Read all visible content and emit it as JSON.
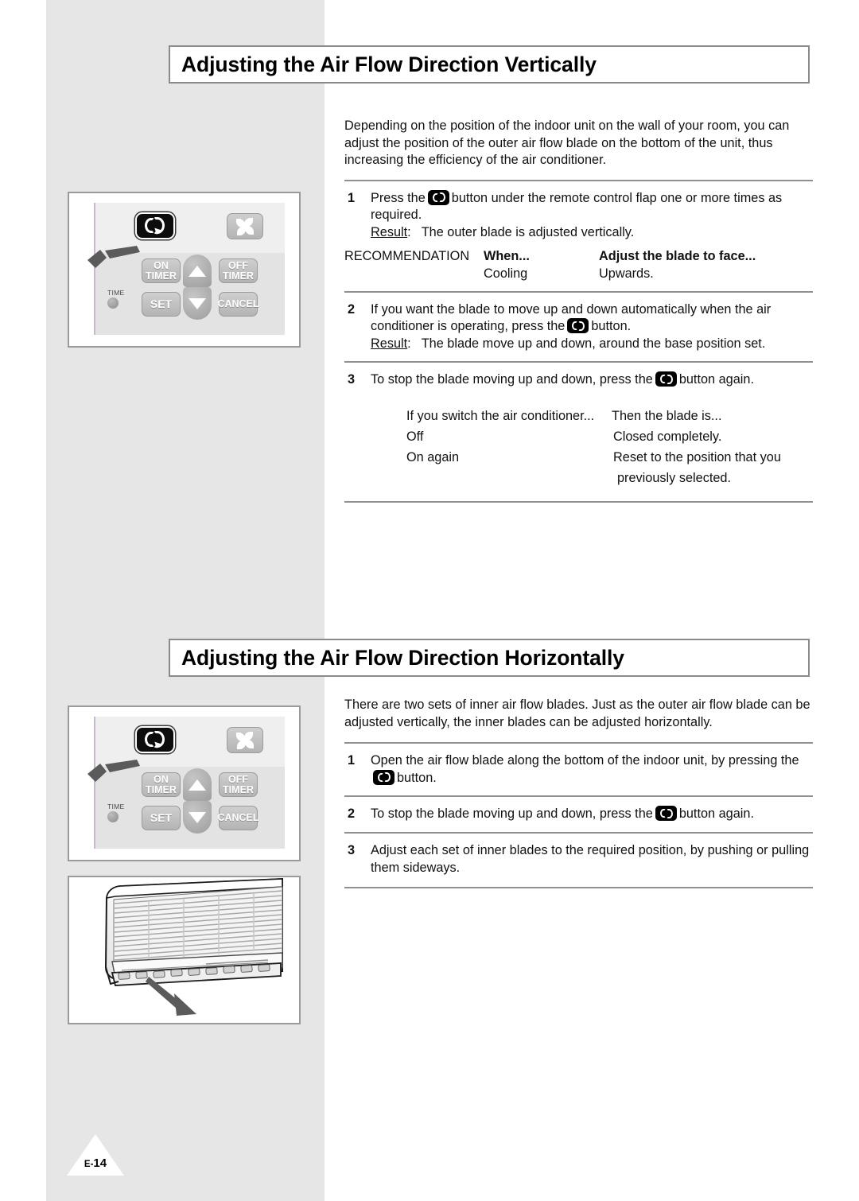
{
  "page": {
    "number_prefix": "E-",
    "number_value": "14"
  },
  "sections": [
    {
      "title": "Adjusting the Air Flow Direction Vertically",
      "intro": "Depending on the position of the indoor unit on the wall of your room, you can adjust the position of the outer air flow blade on the bottom of the unit, thus increasing the efficiency of the air conditioner.",
      "steps": [
        {
          "num": "1",
          "text_before": "Press the",
          "text_after": "button under the remote control flap one or more times as required.",
          "result_label": "Result",
          "result_colon": ":",
          "result_text": "The outer blade is adjusted vertically."
        },
        {
          "num": "2",
          "text_before": "If you want the blade to move up and down automatically when the air conditioner is operating, press the",
          "text_after": "button.",
          "result_label": "Result",
          "result_colon": ":",
          "result_text": "The blade move up and down, around the base position set."
        },
        {
          "num": "3",
          "text_before": "To stop the blade moving up and down, press the",
          "text_after": "button again.",
          "result_label": "",
          "result_colon": "",
          "result_text": ""
        }
      ],
      "recommendation": {
        "label": "RECOMMENDATION",
        "header_when": "When...",
        "header_adjust": "Adjust the blade to face...",
        "rows": [
          {
            "when": "Cooling",
            "adjust": "Upwards."
          }
        ]
      },
      "switch_table": {
        "header_left": "If you switch the air conditioner...",
        "header_right": "Then the blade is...",
        "rows": [
          {
            "left": "Off",
            "right": "Closed completely.",
            "right2": ""
          },
          {
            "left": "On again",
            "right": "Reset to the position that you",
            "right2": "previously selected."
          }
        ]
      }
    },
    {
      "title": "Adjusting the Air Flow Direction Horizontally",
      "intro": "There are two sets of inner air flow blades. Just as the outer air flow blade can be adjusted vertically, the inner blades can be adjusted horizontally.",
      "steps": [
        {
          "num": "1",
          "text_before": "Open the air flow blade along the bottom of the indoor unit, by pressing the",
          "text_after": "button."
        },
        {
          "num": "2",
          "text_before": "To stop the blade moving up and down, press the",
          "text_after": "button again."
        },
        {
          "num": "3",
          "text_before": "Adjust each set of inner blades to the required position, by pushing or pulling them sideways.",
          "text_after": ""
        }
      ]
    }
  ],
  "remote": {
    "keys": {
      "swing": "swing-blade-icon",
      "fan": "fan-speed-icon",
      "on_timer_line1": "ON",
      "on_timer_line2": "TIMER",
      "off_timer_line1": "OFF",
      "off_timer_line2": "TIMER",
      "set": "SET",
      "cancel": "CANCEL",
      "up": "up-arrow-icon",
      "down": "down-arrow-icon"
    },
    "time_indicator_label": "TIME"
  },
  "colors": {
    "page_background": "#ffffff",
    "side_band": "#e6e6e6",
    "rule": "#909090",
    "frame_border": "#9a9a9a",
    "text": "#111111",
    "key_face": "#c0c0c0",
    "swing_key": "#0d0d0d"
  }
}
